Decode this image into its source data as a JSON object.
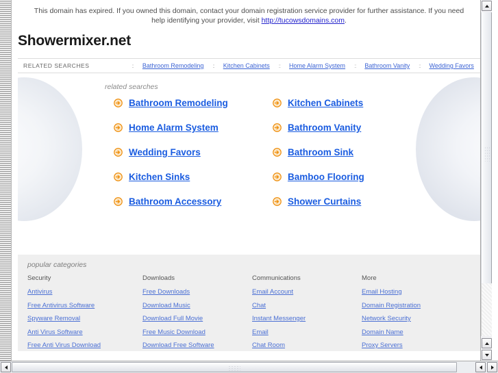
{
  "banner": {
    "text_before": "This domain has expired. If you owned this domain, contact your domain registration service provider for further assistance. If you need help identifying your provider, visit ",
    "link_text": "http://tucowsdomains.com",
    "text_after": "."
  },
  "domain_title": "Showermixer.net",
  "nav": {
    "label": "RELATED SEARCHES",
    "separator": "::",
    "links": [
      "Bathroom Remodeling",
      "Kitchen Cabinets",
      "Home Alarm System",
      "Bathroom Vanity",
      "Wedding Favors"
    ]
  },
  "related": {
    "caption": "related searches",
    "items": [
      "Bathroom Remodeling",
      "Kitchen Cabinets",
      "Home Alarm System",
      "Bathroom Vanity",
      "Wedding Favors",
      "Bathroom Sink",
      "Kitchen Sinks",
      "Bamboo Flooring",
      "Bathroom Accessory",
      "Shower Curtains"
    ]
  },
  "categories": {
    "caption": "popular categories",
    "columns": [
      {
        "heading": "Security",
        "links": [
          "Antivirus",
          "Free Antivirus Software",
          "Spyware Removal",
          "Anti Virus Software",
          "Free Anti Virus Download"
        ]
      },
      {
        "heading": "Downloads",
        "links": [
          "Free Downloads",
          "Download Music",
          "Download Full Movie",
          "Free Music Download",
          "Download Free Software"
        ]
      },
      {
        "heading": "Communications",
        "links": [
          "Email Account",
          "Chat",
          "Instant Messenger",
          "Email",
          "Chat Room"
        ]
      },
      {
        "heading": "More",
        "links": [
          "Email Hosting",
          "Domain Registration",
          "Network Security",
          "Domain Name",
          "Proxy Servers"
        ]
      }
    ]
  },
  "colors": {
    "link_blue": "#1a5ce0",
    "nav_link_blue": "#3b63d4",
    "footer_link_blue": "#4a6fd4",
    "arrow_orange": "#f0920c",
    "footer_bg": "#efefef"
  },
  "icons": {
    "arrow_right_circle": "arrow-right-circle-icon",
    "scroll_up": "triangle-up-icon",
    "scroll_down": "triangle-down-icon",
    "scroll_left": "triangle-left-icon",
    "scroll_right": "triangle-right-icon"
  }
}
